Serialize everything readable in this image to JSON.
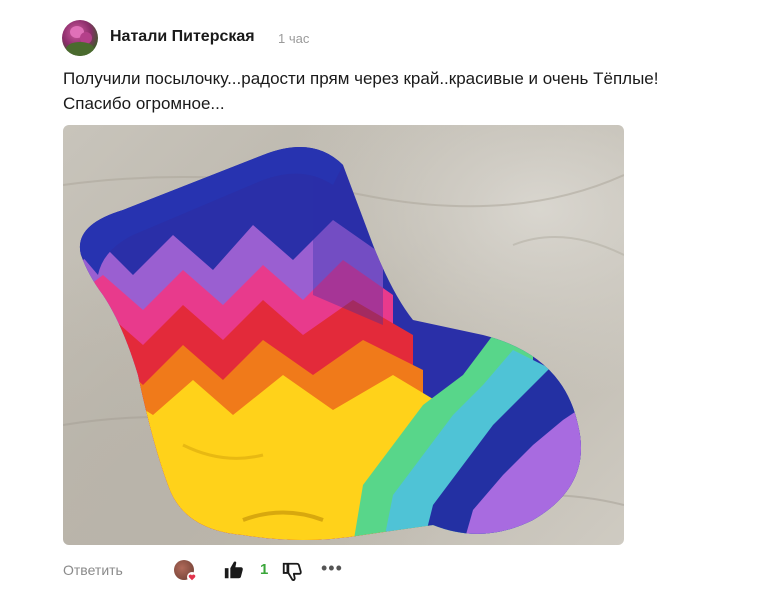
{
  "comment": {
    "author": "Натали Питерская",
    "time": "1 час",
    "text_line1": "Получили посылочку...радости прям через край..красивые и очень Тёплые!",
    "text_line2": "Спасибо огромное...",
    "photo": {
      "subject": "rainbow knitted sock"
    },
    "actions": {
      "reply_label": "Ответить",
      "like_count": "1",
      "more_label": "•••"
    },
    "colors": {
      "like_count": "#3aa63a",
      "muted_text": "#8a8a8a",
      "reaction_heart": "#e2334c"
    },
    "icons": {
      "like": "thumbs-up-icon",
      "dislike": "thumbs-down-icon",
      "more": "more-dots-icon",
      "reaction": "heart-icon"
    }
  }
}
